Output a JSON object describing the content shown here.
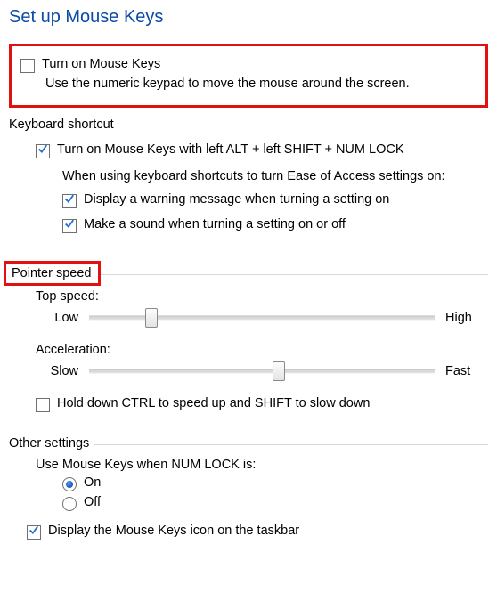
{
  "title": "Set up Mouse Keys",
  "turnOn": {
    "label": "Turn on Mouse Keys",
    "checked": false,
    "description": "Use the numeric keypad to move the mouse around the screen."
  },
  "keyboardShortcut": {
    "legend": "Keyboard shortcut",
    "enable": {
      "label": "Turn on Mouse Keys with left ALT + left SHIFT + NUM LOCK",
      "checked": true
    },
    "note": "When using keyboard shortcuts to turn Ease of Access settings on:",
    "warning": {
      "label": "Display a warning message when turning a setting on",
      "checked": true
    },
    "sound": {
      "label": "Make a sound when turning a setting on or off",
      "checked": true
    }
  },
  "pointerSpeed": {
    "legend": "Pointer speed",
    "topSpeed": {
      "label": "Top speed:",
      "low": "Low",
      "high": "High",
      "valuePercent": 18
    },
    "acceleration": {
      "label": "Acceleration:",
      "low": "Slow",
      "high": "Fast",
      "valuePercent": 55
    },
    "ctrlShift": {
      "label": "Hold down CTRL to speed up and SHIFT to slow down",
      "checked": false
    }
  },
  "otherSettings": {
    "legend": "Other settings",
    "numlockLabel": "Use Mouse Keys when NUM LOCK is:",
    "on": {
      "label": "On",
      "selected": true
    },
    "off": {
      "label": "Off",
      "selected": false
    },
    "taskbarIcon": {
      "label": "Display the Mouse Keys icon on the taskbar",
      "checked": true
    }
  }
}
